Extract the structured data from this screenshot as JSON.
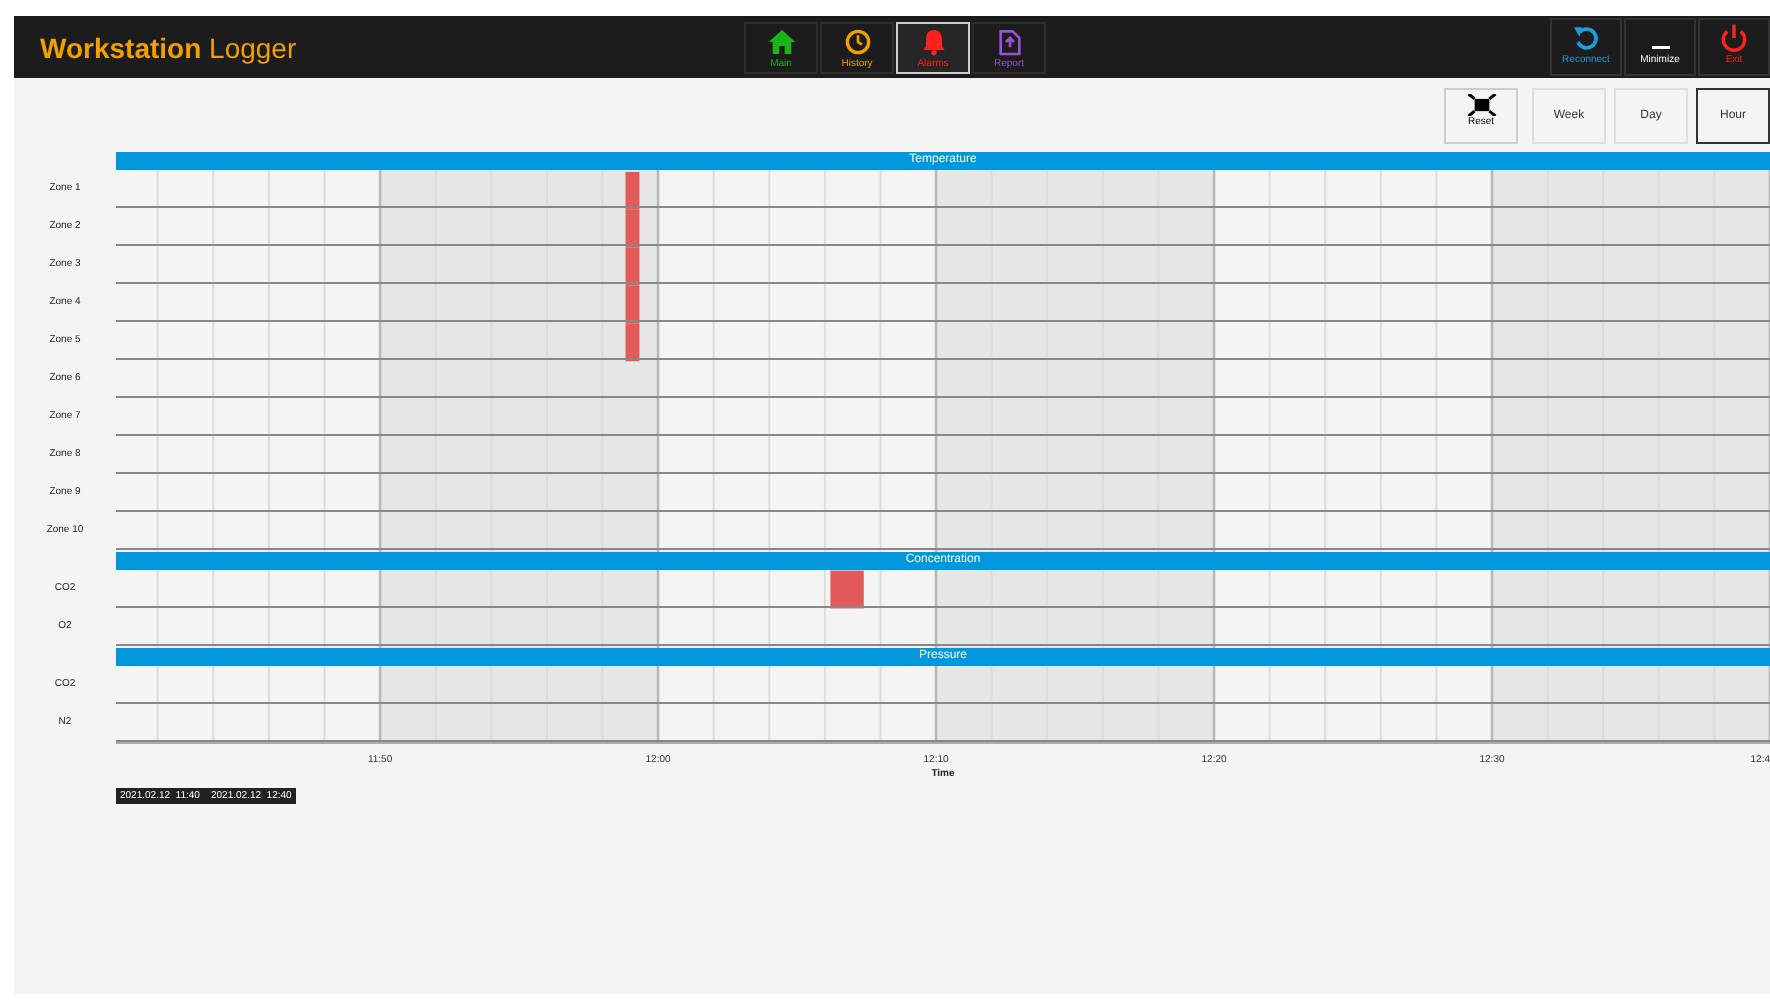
{
  "app": {
    "title_bold": "Workstation",
    "title_rest": "Logger"
  },
  "nav": [
    {
      "kind": "home",
      "label": "Main",
      "selected": false
    },
    {
      "kind": "history",
      "label": "History",
      "selected": false
    },
    {
      "kind": "alarm",
      "label": "Alarms",
      "selected": true
    },
    {
      "kind": "report",
      "label": "Report",
      "selected": false
    }
  ],
  "window_buttons": [
    {
      "kind": "reconnect",
      "label": "Reconnect"
    },
    {
      "kind": "minimize",
      "label": "Minimize"
    },
    {
      "kind": "exit",
      "label": "Exit"
    }
  ],
  "reset_button": {
    "label": "Reset"
  },
  "range_buttons": [
    {
      "label": "Week",
      "selected": false
    },
    {
      "label": "Day",
      "selected": false
    },
    {
      "label": "Hour",
      "selected": true
    }
  ],
  "timeline": {
    "groups": [
      {
        "title": "Temperature",
        "rows": [
          {
            "label": "Zone 1",
            "alarm": true
          },
          {
            "label": "Zone 2",
            "alarm": true
          },
          {
            "label": "Zone 3",
            "alarm": true
          },
          {
            "label": "Zone 4",
            "alarm": true
          },
          {
            "label": "Zone 5",
            "alarm": true
          },
          {
            "label": "Zone 6",
            "alarm": false
          },
          {
            "label": "Zone 7",
            "alarm": false
          },
          {
            "label": "Zone 8",
            "alarm": false
          },
          {
            "label": "Zone 9",
            "alarm": false
          },
          {
            "label": "Zone 10",
            "alarm": false
          }
        ]
      },
      {
        "title": "Concentration",
        "rows": [
          {
            "label": "CO2",
            "alarm": true
          },
          {
            "label": "O2",
            "alarm": false
          }
        ]
      },
      {
        "title": "Pressure",
        "rows": [
          {
            "label": "CO2",
            "alarm": false
          },
          {
            "label": "N2",
            "alarm": false
          }
        ]
      }
    ],
    "ticks": [
      "11:50",
      "12:00",
      "12:10",
      "12:20",
      "12:30",
      "12:4"
    ],
    "xlabel": "Time",
    "range_label": "2021.02.12  11:40    2021.02.12  12:40"
  }
}
